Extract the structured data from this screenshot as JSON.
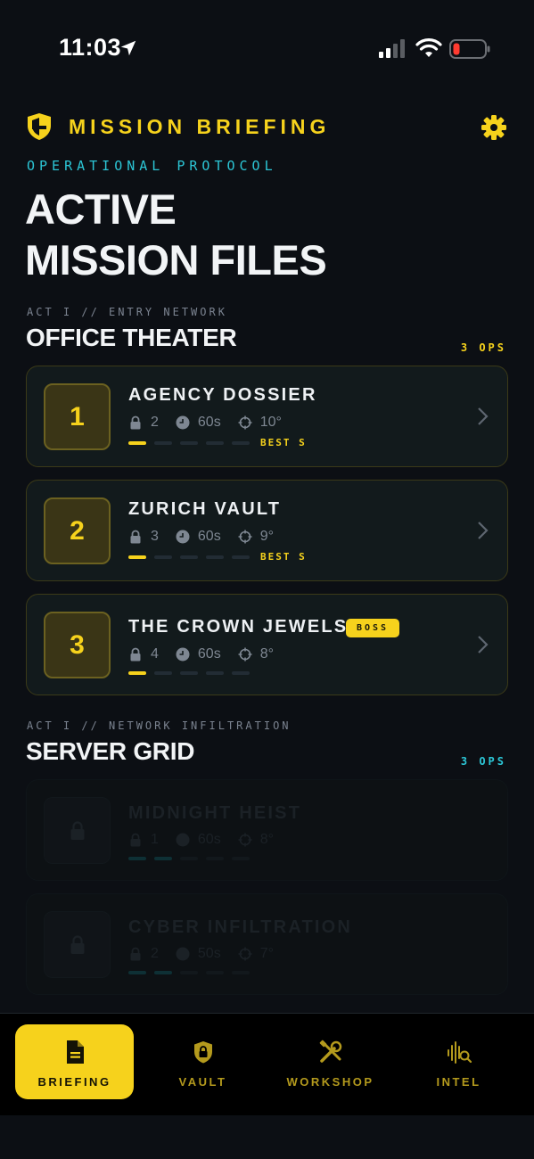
{
  "status_bar": {
    "time": "11:03"
  },
  "header": {
    "brand": "MISSION BRIEFING",
    "subtitle": "OPERATIONAL PROTOCOL",
    "hero_line1": "ACTIVE",
    "hero_line2": "MISSION FILES"
  },
  "sections": [
    {
      "act": "ACT I // ENTRY NETWORK",
      "title": "OFFICE THEATER",
      "ops": "3 OPS",
      "missions": [
        {
          "number": "1",
          "title": "AGENCY DOSSIER",
          "locks": "2",
          "time": "60s",
          "angle": "10°",
          "best": "BEST S",
          "progress_filled": 1,
          "progress_total": 5
        },
        {
          "number": "2",
          "title": "ZURICH VAULT",
          "locks": "3",
          "time": "60s",
          "angle": "9°",
          "best": "BEST S",
          "progress_filled": 1,
          "progress_total": 5
        },
        {
          "number": "3",
          "title": "THE CROWN JEWELS",
          "badge": "BOSS",
          "locks": "4",
          "time": "60s",
          "angle": "8°",
          "progress_filled": 1,
          "progress_total": 5
        }
      ]
    },
    {
      "act": "ACT I // NETWORK INFILTRATION",
      "title": "SERVER GRID",
      "ops": "3 OPS",
      "missions": [
        {
          "title": "MIDNIGHT HEIST",
          "locks": "1",
          "time": "60s",
          "angle": "8°",
          "locked": true,
          "progress_filled": 2,
          "progress_total": 5
        },
        {
          "title": "CYBER INFILTRATION",
          "locks": "2",
          "time": "50s",
          "angle": "7°",
          "locked": true,
          "progress_filled": 2,
          "progress_total": 5
        }
      ]
    }
  ],
  "nav": {
    "items": [
      {
        "label": "BRIEFING",
        "icon": "document-icon",
        "active": true
      },
      {
        "label": "VAULT",
        "icon": "lock-shield-icon",
        "active": false
      },
      {
        "label": "WORKSHOP",
        "icon": "tools-icon",
        "active": false
      },
      {
        "label": "INTEL",
        "icon": "signal-search-icon",
        "active": false
      }
    ]
  },
  "colors": {
    "accent": "#f6d21c",
    "cyan": "#2cc6d6",
    "background": "#0c0f14",
    "card": "#121a1c"
  }
}
